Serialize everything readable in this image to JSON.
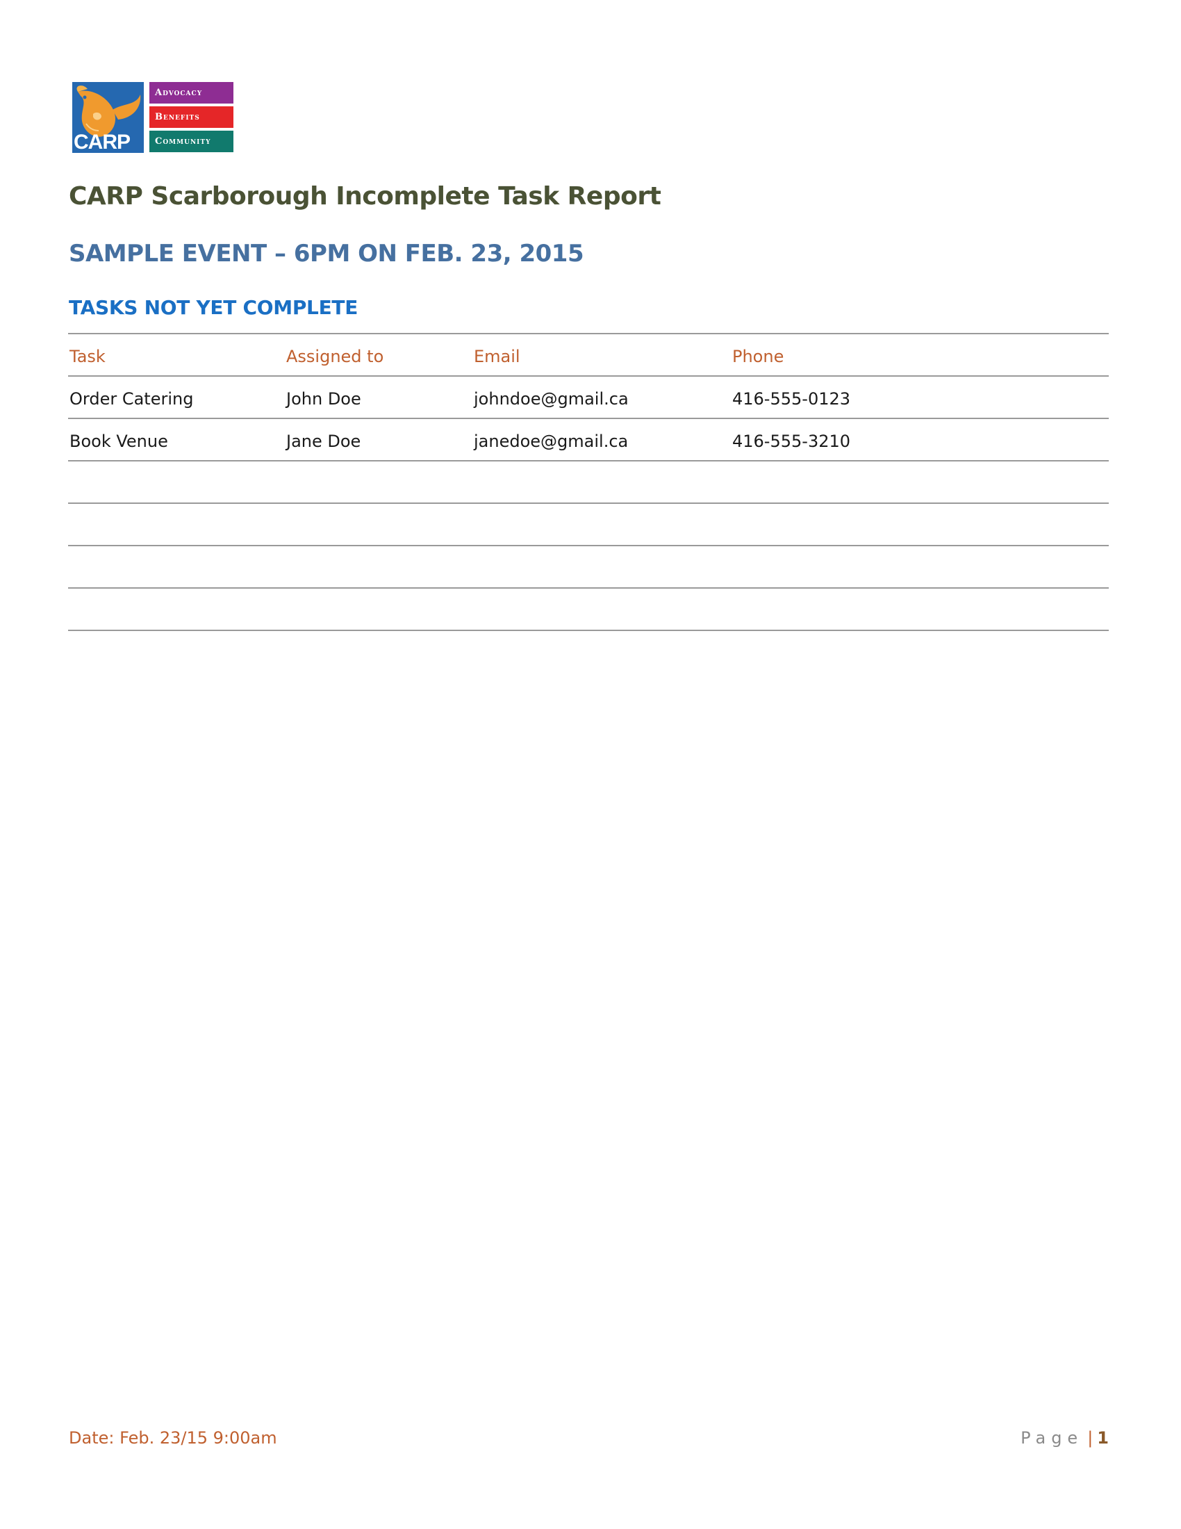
{
  "logo": {
    "word": "CARP",
    "bars": [
      "Advocacy",
      "Benefits",
      "Community"
    ],
    "icon": "koi-fish-icon"
  },
  "report": {
    "title": "CARP Scarborough Incomplete Task Report",
    "event": "SAMPLE EVENT – 6PM ON FEB. 23, 2015",
    "section": "TASKS NOT YET COMPLETE"
  },
  "table": {
    "headers": [
      "Task",
      "Assigned to",
      "Email",
      "Phone"
    ],
    "rows": [
      [
        "Order Catering",
        "John Doe",
        "johndoe@gmail.ca",
        "416-555-0123"
      ],
      [
        "Book Venue",
        "Jane Doe",
        "janedoe@gmail.ca",
        "416-555-3210"
      ],
      [
        "",
        "",
        "",
        ""
      ],
      [
        "",
        "",
        "",
        ""
      ],
      [
        "",
        "",
        "",
        ""
      ],
      [
        "",
        "",
        "",
        ""
      ]
    ]
  },
  "footer": {
    "date": "Date: Feb. 23/15 9:00am",
    "page_label": "Page",
    "separator": "|",
    "page_number": "1"
  },
  "colors": {
    "title": "#4a5235",
    "event": "#4670a0",
    "section": "#1a6fc4",
    "header_text": "#c0602f",
    "logo_blue": "#2568b0",
    "logo_purple": "#8e2d93",
    "logo_red": "#e52628",
    "logo_green": "#117a6d"
  }
}
